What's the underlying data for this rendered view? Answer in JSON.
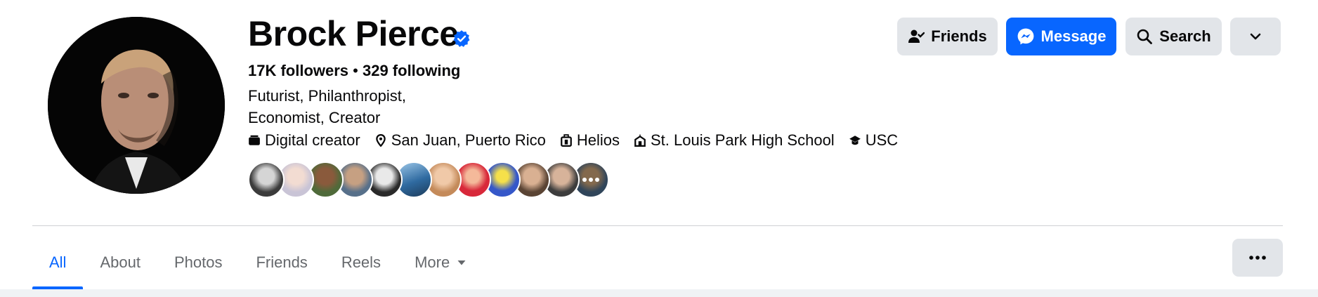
{
  "profile": {
    "name": "Brock Pierce",
    "verified_icon": "verified-badge-icon",
    "followers": "17K followers",
    "separator": " • ",
    "following": "329 following",
    "bio_line1": "Futurist, Philanthropist,",
    "bio_line2": "Economist, Creator",
    "details": [
      {
        "icon": "video-camera-icon",
        "text": "Digital creator"
      },
      {
        "icon": "location-pin-icon",
        "text": "San Juan, Puerto Rico"
      },
      {
        "icon": "briefcase-icon",
        "text": "Helios"
      },
      {
        "icon": "school-icon",
        "text": "St. Louis Park High School"
      },
      {
        "icon": "graduation-cap-icon",
        "text": "USC"
      }
    ]
  },
  "actions": {
    "friends": "Friends",
    "message": "Message",
    "search": "Search",
    "dropdown_icon": "chevron-down-icon"
  },
  "tabs": [
    {
      "label": "All",
      "active": true
    },
    {
      "label": "About"
    },
    {
      "label": "Photos"
    },
    {
      "label": "Friends"
    },
    {
      "label": "Reels"
    },
    {
      "label": "More"
    }
  ],
  "colors": {
    "accent": "#0866ff",
    "button_gray": "#e2e5e9",
    "text": "#080809",
    "muted_text": "#65686c"
  }
}
